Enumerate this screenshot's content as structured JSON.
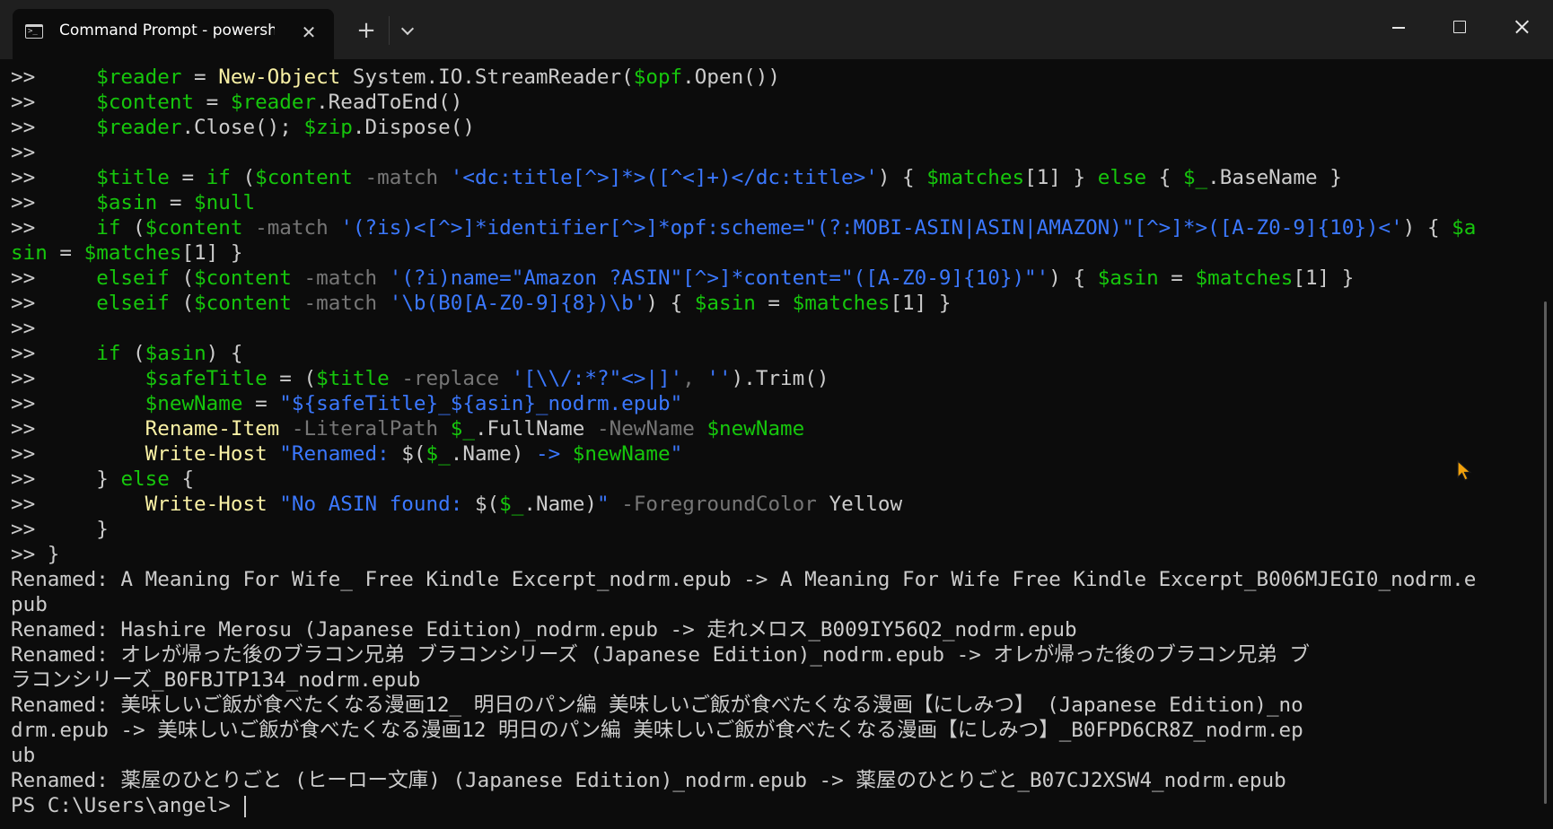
{
  "window": {
    "tab_title": "Command Prompt - powersh",
    "tab_close_symbol": "✕",
    "new_tab_symbol": "+",
    "tab_icon": "terminal-icon",
    "dropdown_icon": "chevron-down-icon"
  },
  "colors": {
    "background": "#0c0c0c",
    "titlebar": "#1f1f1f",
    "default_text": "#cccccc",
    "variable_green": "#16c60c",
    "command_yellow": "#f9f1a5",
    "string_blue": "#3b78ff",
    "operator_gray": "#767676",
    "mouse_cursor": "#f2a20c"
  },
  "terminal": {
    "lines": [
      [
        [
          "d",
          ">>     "
        ],
        [
          "g",
          "$reader"
        ],
        [
          "d",
          " = "
        ],
        [
          "y",
          "New-Object"
        ],
        [
          "d",
          " System.IO.StreamReader("
        ],
        [
          "g",
          "$opf"
        ],
        [
          "d",
          ".Open())"
        ]
      ],
      [
        [
          "d",
          ">>     "
        ],
        [
          "g",
          "$content"
        ],
        [
          "d",
          " = "
        ],
        [
          "g",
          "$reader"
        ],
        [
          "d",
          ".ReadToEnd()"
        ]
      ],
      [
        [
          "d",
          ">>     "
        ],
        [
          "g",
          "$reader"
        ],
        [
          "d",
          ".Close(); "
        ],
        [
          "g",
          "$zip"
        ],
        [
          "d",
          ".Dispose()"
        ]
      ],
      [
        [
          "d",
          ">>"
        ]
      ],
      [
        [
          "d",
          ">>     "
        ],
        [
          "g",
          "$title"
        ],
        [
          "d",
          " = "
        ],
        [
          "g",
          "if"
        ],
        [
          "d",
          " ("
        ],
        [
          "g",
          "$content"
        ],
        [
          "o",
          " -match"
        ],
        [
          "d",
          " "
        ],
        [
          "s",
          "'<dc:title[^>]*>([^<]+)</dc:title>'"
        ],
        [
          "d",
          ") { "
        ],
        [
          "g",
          "$matches"
        ],
        [
          "d",
          "[1] } "
        ],
        [
          "g",
          "else"
        ],
        [
          "d",
          " { "
        ],
        [
          "g",
          "$_"
        ],
        [
          "d",
          ".BaseName }"
        ]
      ],
      [
        [
          "d",
          ">>     "
        ],
        [
          "g",
          "$asin"
        ],
        [
          "d",
          " = "
        ],
        [
          "g",
          "$null"
        ]
      ],
      [
        [
          "d",
          ">>     "
        ],
        [
          "g",
          "if"
        ],
        [
          "d",
          " ("
        ],
        [
          "g",
          "$content"
        ],
        [
          "o",
          " -match"
        ],
        [
          "d",
          " "
        ],
        [
          "s",
          "'(?is)<[^>]*identifier[^>]*opf:scheme=\"(?:MOBI-ASIN|ASIN|AMAZON)\"[^>]*>([A-Z0-9]{10})<'"
        ],
        [
          "d",
          ") { "
        ],
        [
          "g",
          "$a"
        ]
      ],
      [
        [
          "g",
          "sin"
        ],
        [
          "d",
          " = "
        ],
        [
          "g",
          "$matches"
        ],
        [
          "d",
          "[1] }"
        ]
      ],
      [
        [
          "d",
          ">>     "
        ],
        [
          "g",
          "elseif"
        ],
        [
          "d",
          " ("
        ],
        [
          "g",
          "$content"
        ],
        [
          "o",
          " -match"
        ],
        [
          "d",
          " "
        ],
        [
          "s",
          "'(?i)name=\"Amazon ?ASIN\"[^>]*content=\"([A-Z0-9]{10})\"'"
        ],
        [
          "d",
          ") { "
        ],
        [
          "g",
          "$asin"
        ],
        [
          "d",
          " = "
        ],
        [
          "g",
          "$matches"
        ],
        [
          "d",
          "[1] }"
        ]
      ],
      [
        [
          "d",
          ">>     "
        ],
        [
          "g",
          "elseif"
        ],
        [
          "d",
          " ("
        ],
        [
          "g",
          "$content"
        ],
        [
          "o",
          " -match"
        ],
        [
          "d",
          " "
        ],
        [
          "s",
          "'\\b(B0[A-Z0-9]{8})\\b'"
        ],
        [
          "d",
          ") { "
        ],
        [
          "g",
          "$asin"
        ],
        [
          "d",
          " = "
        ],
        [
          "g",
          "$matches"
        ],
        [
          "d",
          "[1] }"
        ]
      ],
      [
        [
          "d",
          ">>"
        ]
      ],
      [
        [
          "d",
          ">>     "
        ],
        [
          "g",
          "if"
        ],
        [
          "d",
          " ("
        ],
        [
          "g",
          "$asin"
        ],
        [
          "d",
          ") {"
        ]
      ],
      [
        [
          "d",
          ">>         "
        ],
        [
          "g",
          "$safeTitle"
        ],
        [
          "d",
          " = ("
        ],
        [
          "g",
          "$title"
        ],
        [
          "o",
          " -replace"
        ],
        [
          "d",
          " "
        ],
        [
          "s",
          "'[\\\\/:*?\"<>|]'"
        ],
        [
          "o",
          ","
        ],
        [
          "d",
          " "
        ],
        [
          "s",
          "''"
        ],
        [
          "d",
          ").Trim()"
        ]
      ],
      [
        [
          "d",
          ">>         "
        ],
        [
          "g",
          "$newName"
        ],
        [
          "d",
          " = "
        ],
        [
          "s",
          "\"${safeTitle}_${asin}_nodrm.epub\""
        ]
      ],
      [
        [
          "d",
          ">>         "
        ],
        [
          "y",
          "Rename-Item"
        ],
        [
          "o",
          " -LiteralPath"
        ],
        [
          "d",
          " "
        ],
        [
          "g",
          "$_"
        ],
        [
          "d",
          ".FullName"
        ],
        [
          "o",
          " -NewName"
        ],
        [
          "d",
          " "
        ],
        [
          "g",
          "$newName"
        ]
      ],
      [
        [
          "d",
          ">>         "
        ],
        [
          "y",
          "Write-Host"
        ],
        [
          "d",
          " "
        ],
        [
          "s",
          "\"Renamed: "
        ],
        [
          "d",
          "$("
        ],
        [
          "g",
          "$_"
        ],
        [
          "d",
          ".Name)"
        ],
        [
          "s",
          " -> "
        ],
        [
          "g",
          "$newName"
        ],
        [
          "s",
          "\""
        ]
      ],
      [
        [
          "d",
          ">>     } "
        ],
        [
          "g",
          "else"
        ],
        [
          "d",
          " {"
        ]
      ],
      [
        [
          "d",
          ">>         "
        ],
        [
          "y",
          "Write-Host"
        ],
        [
          "d",
          " "
        ],
        [
          "s",
          "\"No ASIN found: "
        ],
        [
          "d",
          "$("
        ],
        [
          "g",
          "$_"
        ],
        [
          "d",
          ".Name)"
        ],
        [
          "s",
          "\""
        ],
        [
          "o",
          " -ForegroundColor"
        ],
        [
          "d",
          " Yellow"
        ]
      ],
      [
        [
          "d",
          ">>     }"
        ]
      ],
      [
        [
          "d",
          ">> }"
        ]
      ],
      [
        [
          "d",
          "Renamed: A Meaning For Wife_ Free Kindle Excerpt_nodrm.epub -> A Meaning For Wife Free Kindle Excerpt_B006MJEGI0_nodrm.e"
        ]
      ],
      [
        [
          "d",
          "pub"
        ]
      ],
      [
        [
          "d",
          "Renamed: Hashire Merosu (Japanese Edition)_nodrm.epub -> 走れメロス_B009IY56Q2_nodrm.epub"
        ]
      ],
      [
        [
          "d",
          "Renamed: オレが帰った後のブラコン兄弟 ブラコンシリーズ (Japanese Edition)_nodrm.epub -> オレが帰った後のブラコン兄弟 ブ"
        ]
      ],
      [
        [
          "d",
          "ラコンシリーズ_B0FBJTP134_nodrm.epub"
        ]
      ],
      [
        [
          "d",
          "Renamed: 美味しいご飯が食べたくなる漫画12_ 明日のパン編 美味しいご飯が食べたくなる漫画【にしみつ】 (Japanese Edition)_no"
        ]
      ],
      [
        [
          "d",
          "drm.epub -> 美味しいご飯が食べたくなる漫画12 明日のパン編 美味しいご飯が食べたくなる漫画【にしみつ】_B0FPD6CR8Z_nodrm.ep"
        ]
      ],
      [
        [
          "d",
          "ub"
        ]
      ],
      [
        [
          "d",
          "Renamed: 薬屋のひとりごと (ヒーロー文庫) (Japanese Edition)_nodrm.epub -> 薬屋のひとりごと_B07CJ2XSW4_nodrm.epub"
        ]
      ],
      [
        [
          "d",
          "PS C:\\Users\\angel> "
        ]
      ]
    ]
  }
}
